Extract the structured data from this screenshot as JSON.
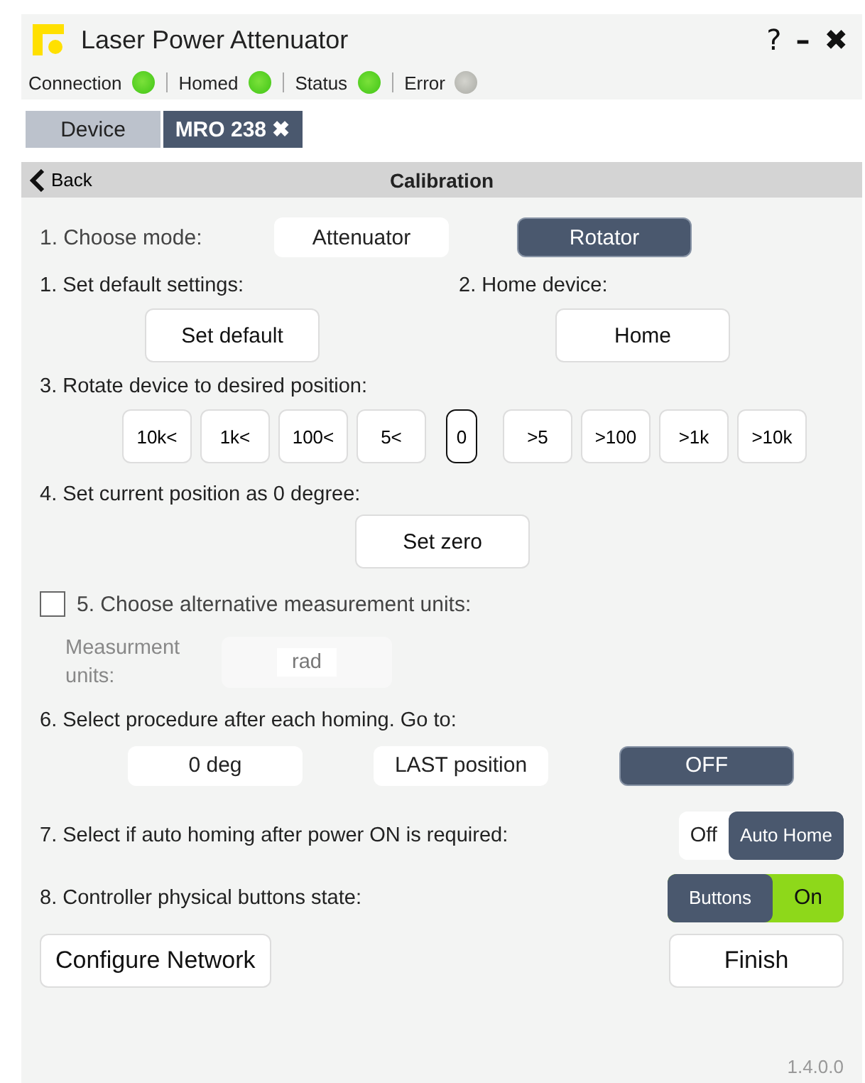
{
  "window": {
    "title": "Laser Power Attenuator",
    "controls": [
      "?",
      "–",
      "✖"
    ]
  },
  "status": [
    {
      "label": "Connection",
      "on": true
    },
    {
      "label": "Homed",
      "on": true
    },
    {
      "label": "Status",
      "on": true
    },
    {
      "label": "Error",
      "on": false
    }
  ],
  "tabs": [
    {
      "label": "Device",
      "selected": false
    },
    {
      "label": "MRO 238",
      "selected": true,
      "close": "✖"
    }
  ],
  "nav": {
    "back": "Back",
    "title": "Calibration"
  },
  "mode": {
    "label": "1. Choose mode:",
    "options": [
      {
        "label": "Attenuator",
        "selected": false
      },
      {
        "label": "Rotator",
        "selected": true
      }
    ]
  },
  "defaults": {
    "label": "1. Set default settings:",
    "button": "Set default"
  },
  "home": {
    "label": "2. Home device:",
    "button": "Home"
  },
  "rotate": {
    "label": "3. Rotate device to desired position:",
    "steps": [
      {
        "label": "10k<",
        "selected": false
      },
      {
        "label": "1k<",
        "selected": false
      },
      {
        "label": "100<",
        "selected": false
      },
      {
        "label": "5<",
        "selected": false
      },
      {
        "label": "0",
        "selected": true
      },
      {
        "label": ">5",
        "selected": false
      },
      {
        "label": ">100",
        "selected": false
      },
      {
        "label": ">1k",
        "selected": false
      },
      {
        "label": ">10k",
        "selected": false
      }
    ]
  },
  "zero": {
    "label": "4. Set current position as 0 degree:",
    "button": "Set zero"
  },
  "units": {
    "checked": false,
    "label": "5. Choose alternative measurement units:",
    "field_label": "Measurment units:",
    "value": "rad",
    "disabled": true
  },
  "homing": {
    "label": "6. Select procedure after each homing. Go to:",
    "options": [
      {
        "label": "0 deg",
        "selected": false
      },
      {
        "label": "LAST position",
        "selected": false
      },
      {
        "label": "OFF",
        "selected": true
      }
    ]
  },
  "auto_home": {
    "label": "7. Select if auto homing after power ON is required:",
    "options": [
      {
        "label": "Off",
        "selected": false
      },
      {
        "label": "Auto Home",
        "selected": true
      }
    ]
  },
  "buttons_state": {
    "label": "8. Controller physical buttons state:",
    "knob": "Buttons",
    "value": "On",
    "on": true
  },
  "footer": {
    "buttons": [
      "Configure Network",
      "Finish"
    ],
    "version": "1.4.0.0"
  }
}
